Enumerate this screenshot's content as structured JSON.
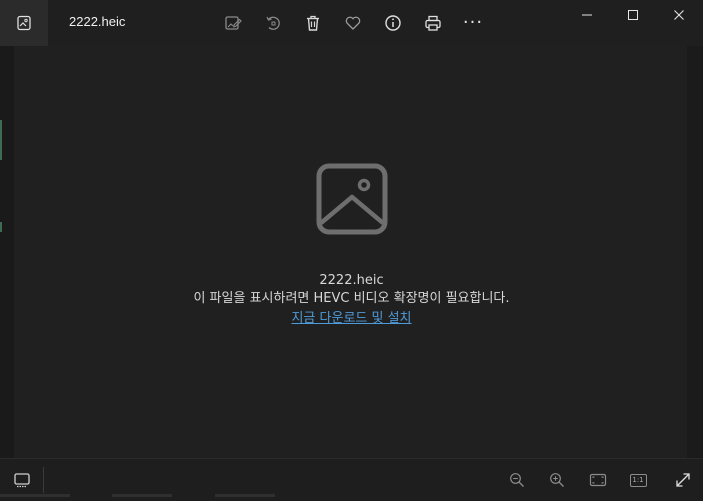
{
  "window": {
    "title": "2222.heic"
  },
  "toolbar": {
    "icons": [
      "edit-image-icon",
      "rotate-icon",
      "delete-icon",
      "favorite-heart-icon",
      "info-icon",
      "print-icon",
      "more-options-icon"
    ],
    "more_label": "···"
  },
  "message": {
    "file_name": "2222.heic",
    "requirement": "이 파일을 표시하려면 HEVC 비디오 확장명이 필요합니다.",
    "link_text": "지금 다운로드 및 설치"
  },
  "bottom_bar": {
    "actual_size_label": "1:1"
  },
  "colors": {
    "background": "#1f1f1f",
    "link": "#4f9bd9",
    "icon": "#c8c8c8"
  }
}
